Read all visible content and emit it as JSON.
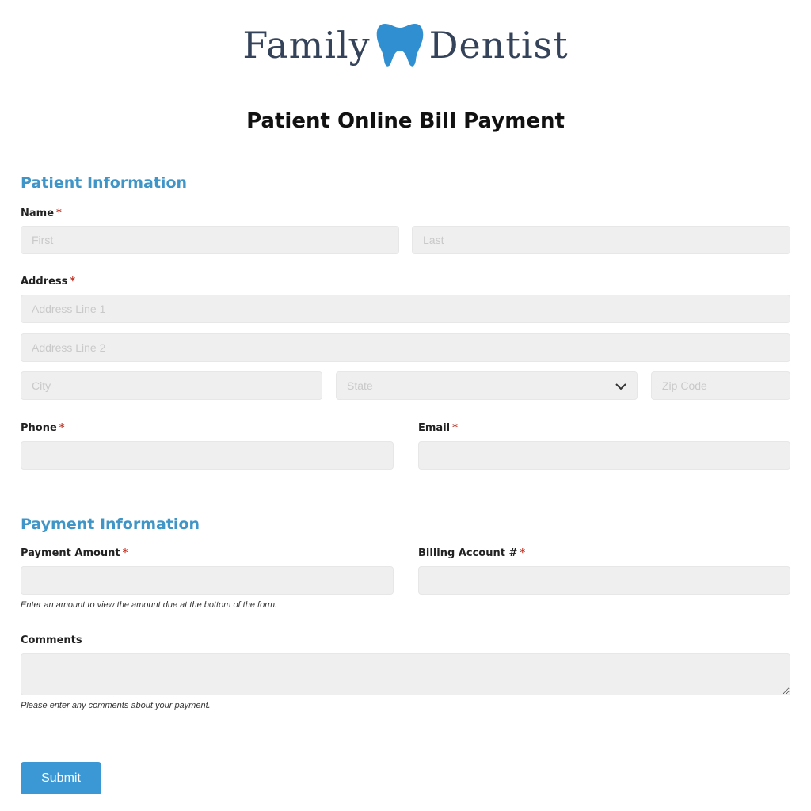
{
  "brand": {
    "word_left": "Family",
    "word_right": "Dentist",
    "logo_color": "#34435a",
    "tooth_color": "#2f8fd1"
  },
  "page": {
    "title": "Patient Online Bill Payment"
  },
  "patient_section": {
    "title": "Patient Information",
    "name": {
      "label": "Name",
      "required_mark": "*",
      "first_placeholder": "First",
      "last_placeholder": "Last"
    },
    "address": {
      "label": "Address",
      "required_mark": "*",
      "line1_placeholder": "Address Line 1",
      "line2_placeholder": "Address Line 2",
      "city_placeholder": "City",
      "state_placeholder": "State",
      "zip_placeholder": "Zip Code"
    },
    "phone": {
      "label": "Phone",
      "required_mark": "*"
    },
    "email": {
      "label": "Email",
      "required_mark": "*"
    }
  },
  "payment_section": {
    "title": "Payment Information",
    "amount": {
      "label": "Payment Amount",
      "required_mark": "*",
      "hint": "Enter an amount to view the amount due at the bottom of the form."
    },
    "billing_account": {
      "label": "Billing Account #",
      "required_mark": "*"
    },
    "comments": {
      "label": "Comments",
      "hint": "Please enter any comments about your payment."
    }
  },
  "submit": {
    "label": "Submit",
    "color": "#3b98d4"
  },
  "colors": {
    "section_title": "#3f95c7",
    "required": "#c0392b",
    "field_bg": "#efefef"
  },
  "icons": {
    "logo": "tooth-icon",
    "select": "chevron-down-icon"
  }
}
